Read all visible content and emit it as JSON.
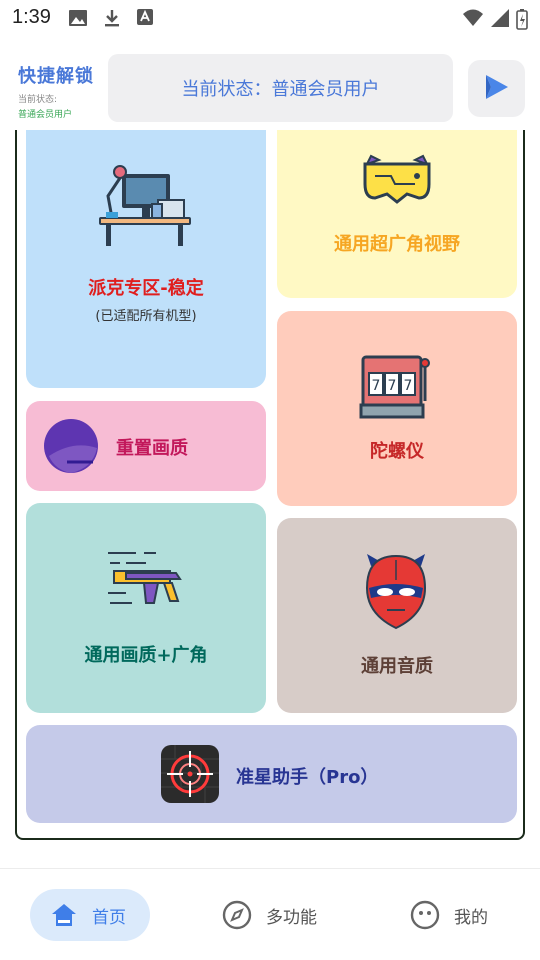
{
  "status_bar": {
    "time": "1:39"
  },
  "header": {
    "brand_title": "快捷解锁",
    "brand_status_label": "当前状态:",
    "brand_status_value": "普通会员用户",
    "status_text": "当前状态：普通会员用户"
  },
  "cards": {
    "pubg_zone": {
      "title": "派克专区-稳定",
      "subtitle": "(已适配所有机型)"
    },
    "wide_view": {
      "title": "通用超广角视野"
    },
    "reset_quality": {
      "title": "重置画质"
    },
    "gyroscope": {
      "title": "陀螺仪"
    },
    "quality_wide": {
      "title": "通用画质+广角"
    },
    "audio": {
      "title": "通用音质"
    },
    "crosshair": {
      "title": "准星助手（Pro）"
    }
  },
  "nav": {
    "home": "首页",
    "multi": "多功能",
    "mine": "我的"
  },
  "colors": {
    "accent": "#4a78d8",
    "nav_active": "#3f7ee8"
  }
}
